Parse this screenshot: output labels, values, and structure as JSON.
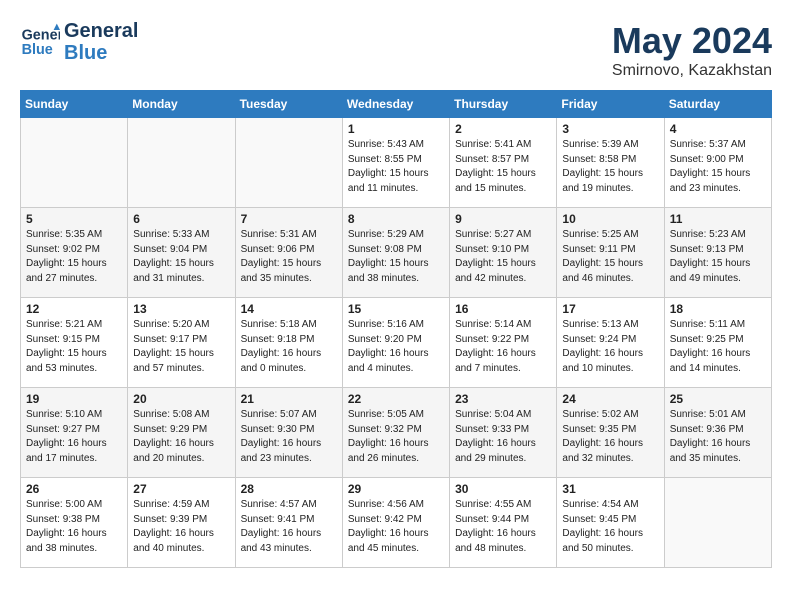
{
  "header": {
    "logo_line1": "General",
    "logo_line2": "Blue",
    "month": "May 2024",
    "location": "Smirnovo, Kazakhstan"
  },
  "weekdays": [
    "Sunday",
    "Monday",
    "Tuesday",
    "Wednesday",
    "Thursday",
    "Friday",
    "Saturday"
  ],
  "weeks": [
    [
      {
        "day": "",
        "content": ""
      },
      {
        "day": "",
        "content": ""
      },
      {
        "day": "",
        "content": ""
      },
      {
        "day": "1",
        "content": "Sunrise: 5:43 AM\nSunset: 8:55 PM\nDaylight: 15 hours\nand 11 minutes."
      },
      {
        "day": "2",
        "content": "Sunrise: 5:41 AM\nSunset: 8:57 PM\nDaylight: 15 hours\nand 15 minutes."
      },
      {
        "day": "3",
        "content": "Sunrise: 5:39 AM\nSunset: 8:58 PM\nDaylight: 15 hours\nand 19 minutes."
      },
      {
        "day": "4",
        "content": "Sunrise: 5:37 AM\nSunset: 9:00 PM\nDaylight: 15 hours\nand 23 minutes."
      }
    ],
    [
      {
        "day": "5",
        "content": "Sunrise: 5:35 AM\nSunset: 9:02 PM\nDaylight: 15 hours\nand 27 minutes."
      },
      {
        "day": "6",
        "content": "Sunrise: 5:33 AM\nSunset: 9:04 PM\nDaylight: 15 hours\nand 31 minutes."
      },
      {
        "day": "7",
        "content": "Sunrise: 5:31 AM\nSunset: 9:06 PM\nDaylight: 15 hours\nand 35 minutes."
      },
      {
        "day": "8",
        "content": "Sunrise: 5:29 AM\nSunset: 9:08 PM\nDaylight: 15 hours\nand 38 minutes."
      },
      {
        "day": "9",
        "content": "Sunrise: 5:27 AM\nSunset: 9:10 PM\nDaylight: 15 hours\nand 42 minutes."
      },
      {
        "day": "10",
        "content": "Sunrise: 5:25 AM\nSunset: 9:11 PM\nDaylight: 15 hours\nand 46 minutes."
      },
      {
        "day": "11",
        "content": "Sunrise: 5:23 AM\nSunset: 9:13 PM\nDaylight: 15 hours\nand 49 minutes."
      }
    ],
    [
      {
        "day": "12",
        "content": "Sunrise: 5:21 AM\nSunset: 9:15 PM\nDaylight: 15 hours\nand 53 minutes."
      },
      {
        "day": "13",
        "content": "Sunrise: 5:20 AM\nSunset: 9:17 PM\nDaylight: 15 hours\nand 57 minutes."
      },
      {
        "day": "14",
        "content": "Sunrise: 5:18 AM\nSunset: 9:18 PM\nDaylight: 16 hours\nand 0 minutes."
      },
      {
        "day": "15",
        "content": "Sunrise: 5:16 AM\nSunset: 9:20 PM\nDaylight: 16 hours\nand 4 minutes."
      },
      {
        "day": "16",
        "content": "Sunrise: 5:14 AM\nSunset: 9:22 PM\nDaylight: 16 hours\nand 7 minutes."
      },
      {
        "day": "17",
        "content": "Sunrise: 5:13 AM\nSunset: 9:24 PM\nDaylight: 16 hours\nand 10 minutes."
      },
      {
        "day": "18",
        "content": "Sunrise: 5:11 AM\nSunset: 9:25 PM\nDaylight: 16 hours\nand 14 minutes."
      }
    ],
    [
      {
        "day": "19",
        "content": "Sunrise: 5:10 AM\nSunset: 9:27 PM\nDaylight: 16 hours\nand 17 minutes."
      },
      {
        "day": "20",
        "content": "Sunrise: 5:08 AM\nSunset: 9:29 PM\nDaylight: 16 hours\nand 20 minutes."
      },
      {
        "day": "21",
        "content": "Sunrise: 5:07 AM\nSunset: 9:30 PM\nDaylight: 16 hours\nand 23 minutes."
      },
      {
        "day": "22",
        "content": "Sunrise: 5:05 AM\nSunset: 9:32 PM\nDaylight: 16 hours\nand 26 minutes."
      },
      {
        "day": "23",
        "content": "Sunrise: 5:04 AM\nSunset: 9:33 PM\nDaylight: 16 hours\nand 29 minutes."
      },
      {
        "day": "24",
        "content": "Sunrise: 5:02 AM\nSunset: 9:35 PM\nDaylight: 16 hours\nand 32 minutes."
      },
      {
        "day": "25",
        "content": "Sunrise: 5:01 AM\nSunset: 9:36 PM\nDaylight: 16 hours\nand 35 minutes."
      }
    ],
    [
      {
        "day": "26",
        "content": "Sunrise: 5:00 AM\nSunset: 9:38 PM\nDaylight: 16 hours\nand 38 minutes."
      },
      {
        "day": "27",
        "content": "Sunrise: 4:59 AM\nSunset: 9:39 PM\nDaylight: 16 hours\nand 40 minutes."
      },
      {
        "day": "28",
        "content": "Sunrise: 4:57 AM\nSunset: 9:41 PM\nDaylight: 16 hours\nand 43 minutes."
      },
      {
        "day": "29",
        "content": "Sunrise: 4:56 AM\nSunset: 9:42 PM\nDaylight: 16 hours\nand 45 minutes."
      },
      {
        "day": "30",
        "content": "Sunrise: 4:55 AM\nSunset: 9:44 PM\nDaylight: 16 hours\nand 48 minutes."
      },
      {
        "day": "31",
        "content": "Sunrise: 4:54 AM\nSunset: 9:45 PM\nDaylight: 16 hours\nand 50 minutes."
      },
      {
        "day": "",
        "content": ""
      }
    ]
  ]
}
